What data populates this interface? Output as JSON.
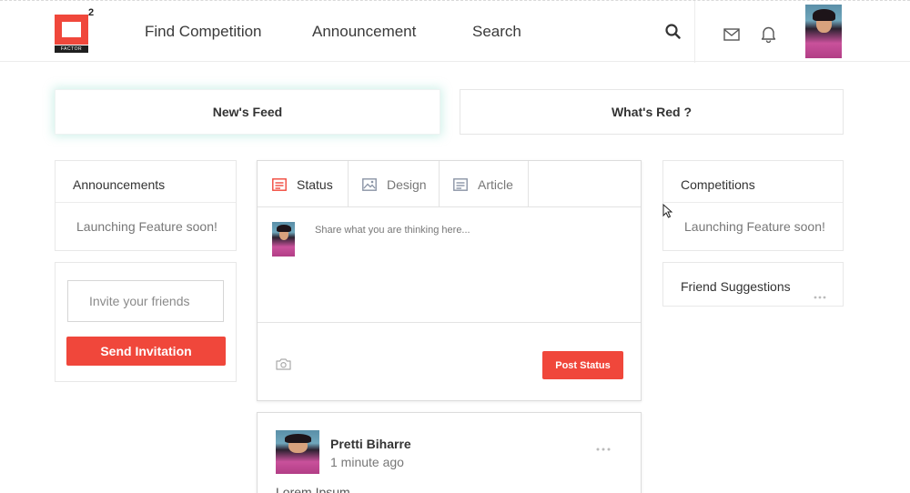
{
  "logo": {
    "mark_sup": "2",
    "wordmark": "FACTOR"
  },
  "nav": {
    "links": [
      "Find Competition",
      "Announcement",
      "Search"
    ],
    "icons": [
      "search-icon",
      "mail-icon",
      "bell-icon"
    ]
  },
  "feed_tabs": {
    "news_feed": "New's Feed",
    "whats_red": "What's Red ?"
  },
  "left": {
    "announcements_title": "Announcements",
    "announcements_text": "Launching Feature soon!",
    "invite_placeholder": "Invite your friends",
    "send_invitation": "Send Invitation"
  },
  "composer": {
    "tabs": [
      {
        "label": "Status",
        "icon": "status-icon"
      },
      {
        "label": "Design",
        "icon": "image-icon"
      },
      {
        "label": "Article",
        "icon": "article-icon"
      }
    ],
    "placeholder": "Share what you are thinking here...",
    "post_status": "Post Status",
    "camera_icon": "camera-icon"
  },
  "post": {
    "author": "Pretti Biharre",
    "time": "1 minute ago",
    "body": "Lorem Ipsum"
  },
  "right": {
    "competitions_title": "Competitions",
    "competitions_text": "Launching Feature soon!",
    "friend_suggestions_title": "Friend Suggestions"
  },
  "colors": {
    "accent": "#f0473b",
    "border": "#e8e8e8",
    "text": "#333333",
    "muted": "#777777"
  }
}
